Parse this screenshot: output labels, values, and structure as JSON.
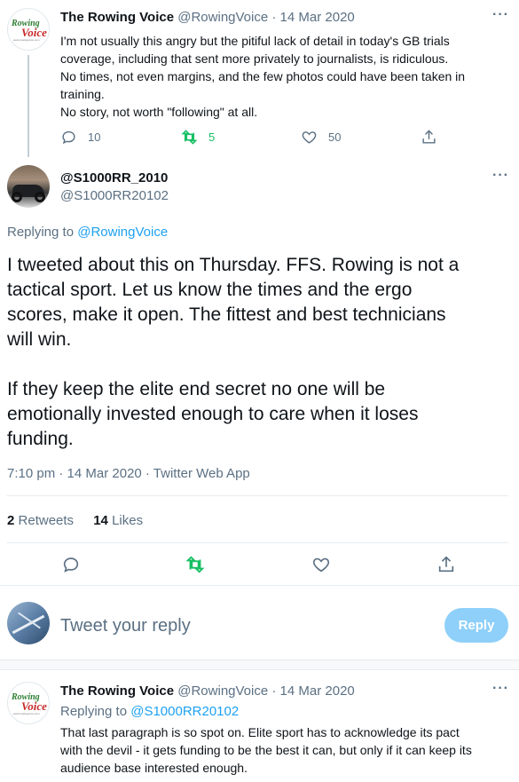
{
  "parent_tweet": {
    "display_name": "The Rowing Voice",
    "handle": "@RowingVoice",
    "sep": " · ",
    "date": "14 Mar 2020",
    "lines": [
      "I'm not usually this angry but the pitiful lack of detail in today's GB trials",
      "coverage, including that sent more privately to journalists, is ridiculous.",
      "No times, not even margins, and the few photos could have been taken in",
      "training.",
      "No story, not worth \"following\" at all."
    ],
    "reply_count": "10",
    "retweet_count": "5",
    "like_count": "50",
    "more_icon": "more-dots-icon"
  },
  "main_tweet": {
    "display_name": "@S1000RR_2010",
    "handle": "@S1000RR20102",
    "replying_prefix": "Replying to ",
    "replying_to": "@RowingVoice",
    "lines": [
      "I tweeted about this on Thursday. FFS. Rowing is not a",
      "tactical sport. Let us know the times and the ergo",
      "scores, make it open. The fittest and best technicians",
      "will win.",
      "",
      "If they keep the elite end secret no one will be",
      "emotionally invested enough to care when it loses",
      "funding."
    ],
    "timestamp": "7:10 pm · 14 Mar 2020 · Twitter Web App",
    "retweets_count": "2",
    "retweets_label": "Retweets",
    "likes_count": "14",
    "likes_label": "Likes"
  },
  "composer": {
    "placeholder": "Tweet your reply",
    "reply_button": "Reply"
  },
  "reply_tweet": {
    "display_name": "The Rowing Voice",
    "handle": "@RowingVoice",
    "sep": " · ",
    "date": "14 Mar 2020",
    "replying_prefix": "Replying to ",
    "replying_to": "@S1000RR20102",
    "lines": [
      "That last paragraph is so spot on. Elite sport has to acknowledge its pact",
      "with the devil - it gets funding to be the best it can, but only if it can keep its",
      "audience base interested enough."
    ]
  },
  "logo": {
    "word1": "Rowing",
    "word2": "Voice",
    "tagline": "www.rowingvoice.com"
  },
  "colors": {
    "accent": "#1da1f2",
    "retweet_green": "#17bf63",
    "muted": "#5b7083",
    "logo_green": "#2e7d32",
    "logo_red": "#c62828"
  }
}
